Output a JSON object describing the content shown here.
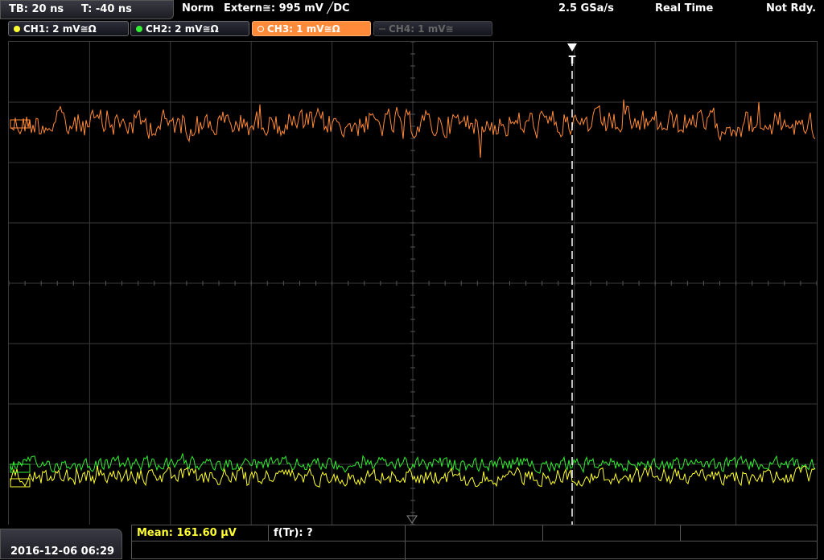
{
  "timebase": {
    "tb_label": "TB: 20 ns",
    "t_label": "T: -40 ns"
  },
  "status": {
    "mode": "Norm",
    "trigger": "Extern≅: 995 mV ╱DC",
    "sample_rate": "2.5 GSa/s",
    "acq_mode": "Real Time",
    "trigger_state": "Not Rdy."
  },
  "channels": [
    {
      "label": "CH1: 2 mV≅Ω",
      "color": "#ffff33",
      "state": "on"
    },
    {
      "label": "CH2: 2 mV≅Ω",
      "color": "#33ee33",
      "state": "on"
    },
    {
      "label": "CH3: 1 mV≅Ω",
      "color": "#ff8a3a",
      "state": "active"
    },
    {
      "label": "CH4: 1 mV≅",
      "color": "#666666",
      "state": "off"
    }
  ],
  "markers": {
    "trigger": "T"
  },
  "measurement": {
    "mean": "Mean: 161.60 µV",
    "ftr": "f(Tr): ?"
  },
  "datetime": "2016-12-06 06:29",
  "colors": {
    "ch1": "#ffff33",
    "ch2": "#33ee33",
    "ch3": "#ff8a3a",
    "grid": "#3a3a3a"
  }
}
